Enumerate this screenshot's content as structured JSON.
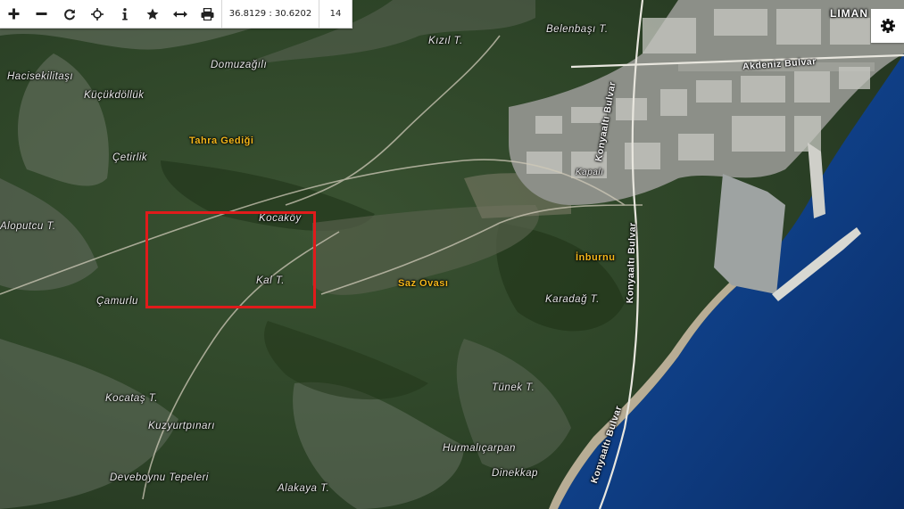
{
  "toolbar": {
    "tools": [
      {
        "icon": "zoom-in-icon"
      },
      {
        "icon": "zoom-out-icon"
      },
      {
        "icon": "refresh-icon"
      },
      {
        "icon": "locate-crosshair-icon"
      },
      {
        "icon": "info-icon"
      },
      {
        "icon": "star-icon"
      },
      {
        "icon": "measure-distance-icon"
      },
      {
        "icon": "print-icon"
      }
    ],
    "coordinates": "36.8129 : 30.6202",
    "zoom_level": "14"
  },
  "settings": {
    "icon": "gear-icon"
  },
  "map": {
    "labels": {
      "hacisekilitasi": "Hacisekilitaşı",
      "domuzagili": "Domuzağılı",
      "kizil_t": "Kızıl T.",
      "belenbasi_t": "Belenbaşı T.",
      "kucukdolluk": "Küçükdöllük",
      "tahra_gedigi": "Tahra Gediği",
      "cetirlik": "Çetirlik",
      "akdeniz_bulvar": "Akdeniz Bulvar",
      "liman": "LIMAN",
      "aloputcu_t": "Aloputcu T.",
      "kocakoy": "Kocaköy",
      "kal_t": "Kal T.",
      "camurlu": "Çamurlu",
      "saz_ovasi": "Saz Ovası",
      "inburnu": "İnburnu",
      "karadag_t": "Karadağ T.",
      "konyaalti_bulvar_1": "Konyaaltı Bulvar",
      "konyaalti_bulvar_2": "Konyaaltı Bulvar",
      "konyaalti_bulvar_3": "Konyaaltı Bulvar",
      "kocatas_t": "Kocataş T.",
      "tunek_t": "Tünek T.",
      "kuzyurtpinari": "Kuzyurtpınarı",
      "hurmalicarpan": "Hurmalıçarpan",
      "dinekkap": "Dinekkap",
      "deveboynu_tepeleri": "Deveboynu Tepeleri",
      "alakaya_t": "Alakaya T.",
      "kapali": "Kapalı"
    },
    "colors": {
      "selection": "#e11b1b",
      "sea": "#0f3f86",
      "vegetation": "#2f4a2a",
      "area_label": "#f2b61b"
    }
  }
}
